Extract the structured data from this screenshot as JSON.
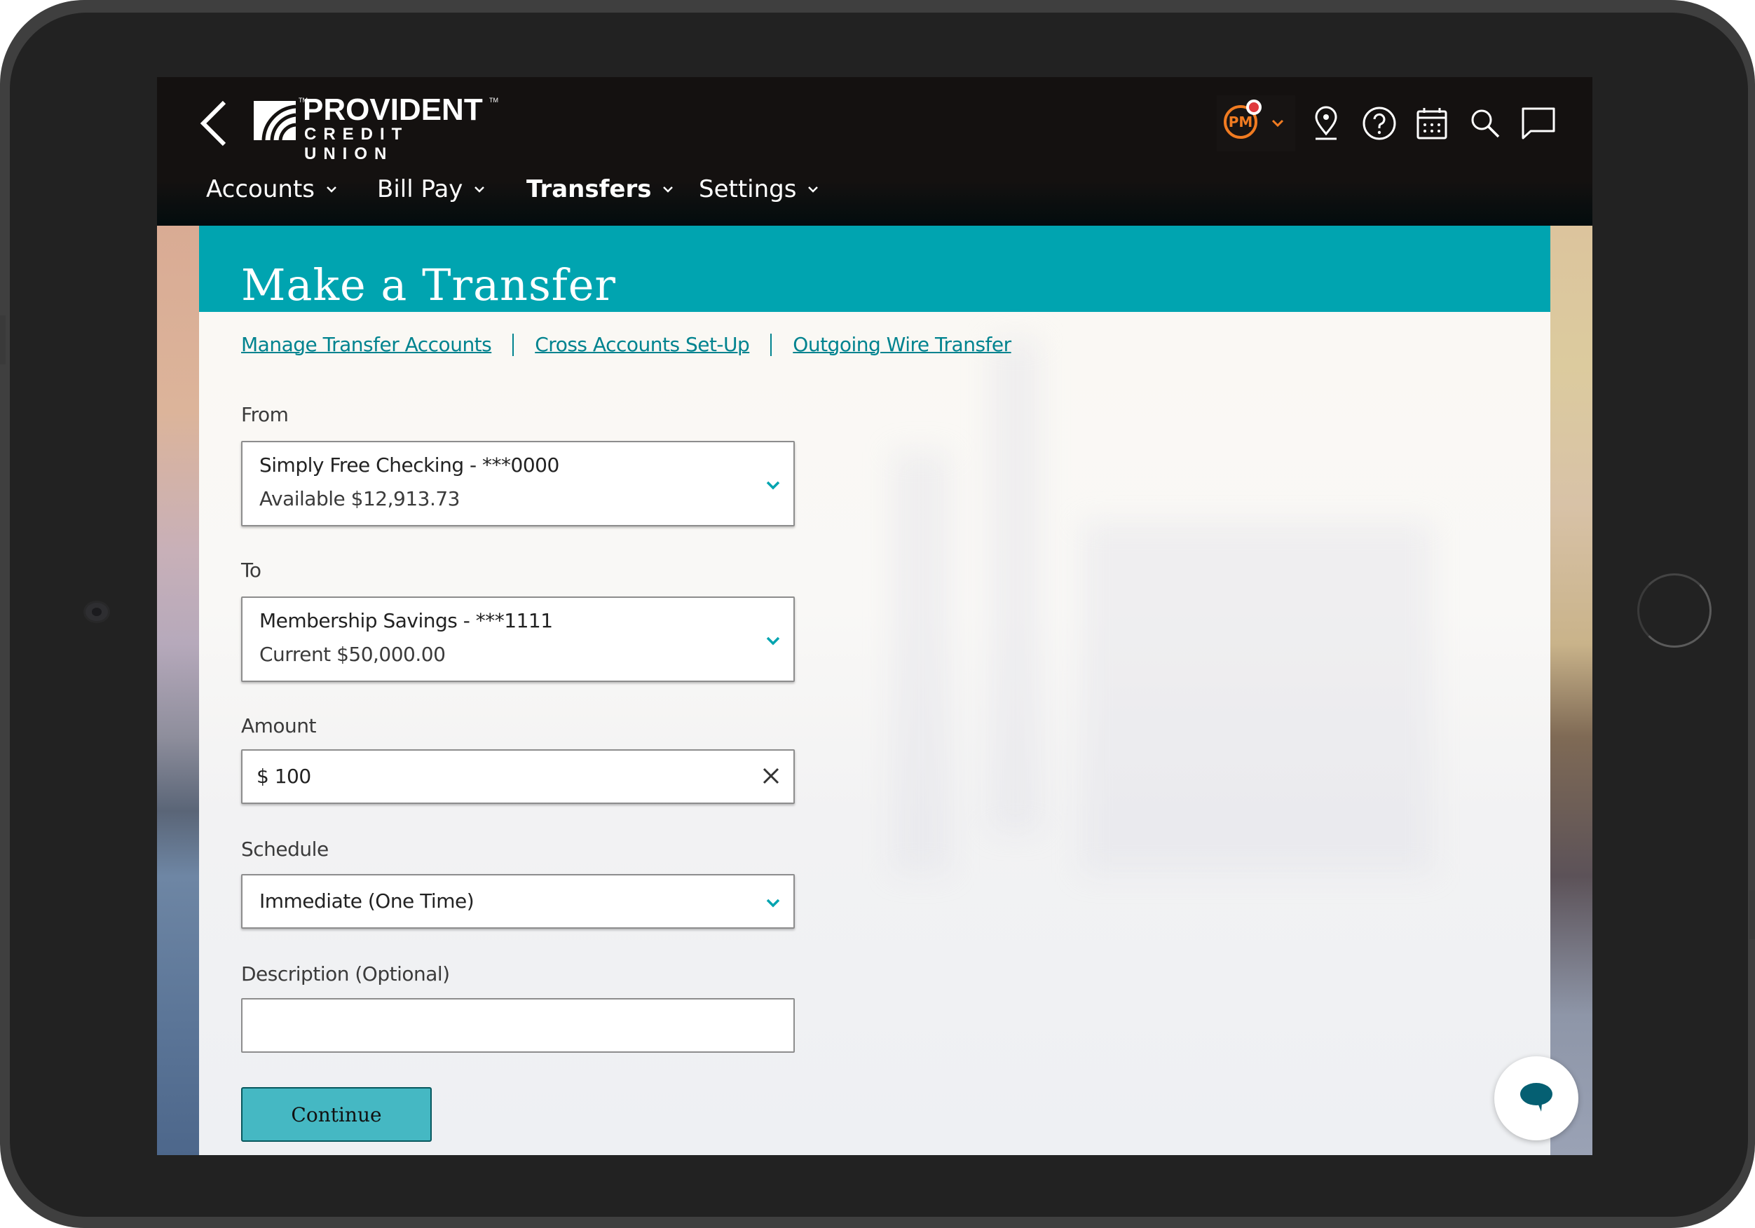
{
  "brand": {
    "name_line1": "PROVIDENT",
    "name_line2": "CREDIT UNION",
    "tm": "TM",
    "accent_color": "#00a4b0",
    "link_color": "#00838f",
    "avatar_color": "#f07b21"
  },
  "header": {
    "back_icon": "chevron-left-icon",
    "nav": [
      {
        "label": "Accounts",
        "active": false
      },
      {
        "label": "Bill Pay",
        "active": false
      },
      {
        "label": "Transfers",
        "active": true
      },
      {
        "label": "Settings",
        "active": false
      }
    ],
    "user": {
      "initials": "PM",
      "has_notification": true
    },
    "icons": [
      "location-pin-icon",
      "help-icon",
      "calendar-icon",
      "search-icon",
      "messages-icon"
    ]
  },
  "page": {
    "title": "Make a Transfer",
    "links": [
      {
        "label": "Manage Transfer Accounts"
      },
      {
        "label": "Cross Accounts Set-Up"
      },
      {
        "label": "Outgoing Wire Transfer"
      }
    ]
  },
  "form": {
    "from": {
      "label": "From",
      "account": "Simply Free Checking - ***0000",
      "balance_label": "Available",
      "balance": "$12,913.73"
    },
    "to": {
      "label": "To",
      "account": "Membership Savings - ***1111",
      "balance_label": "Current",
      "balance": "$50,000.00"
    },
    "amount": {
      "label": "Amount",
      "currency": "$",
      "value": "100"
    },
    "schedule": {
      "label": "Schedule",
      "value": "Immediate (One Time)"
    },
    "description": {
      "label": "Description (Optional)",
      "value": ""
    },
    "continue_label": "Continue"
  },
  "chat_fab": {
    "icon": "chat-bubble-icon"
  }
}
